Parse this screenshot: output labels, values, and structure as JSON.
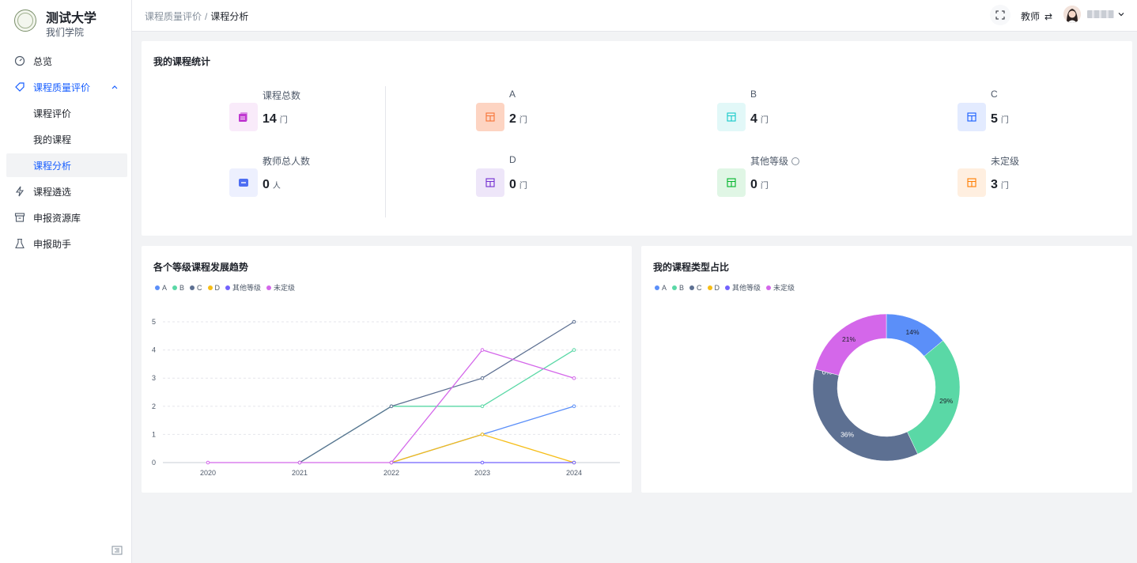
{
  "sidebar": {
    "university": "测试大学",
    "college": "我们学院",
    "items": [
      {
        "label": "总览"
      },
      {
        "label": "课程质量评价"
      },
      {
        "label": "课程评价"
      },
      {
        "label": "我的课程"
      },
      {
        "label": "课程分析"
      },
      {
        "label": "课程遴选"
      },
      {
        "label": "申报资源库"
      },
      {
        "label": "申报助手"
      }
    ]
  },
  "header": {
    "breadcrumb_parent": "课程质量评价",
    "breadcrumb_sep": "/",
    "breadcrumb_current": "课程分析",
    "role": "教师",
    "role_switch_icon": "⇄"
  },
  "stats": {
    "title": "我的课程统计",
    "items": [
      {
        "label": "课程总数",
        "value": "14",
        "unit": "门",
        "icon": "stack-icon",
        "color": "#c03ad1"
      },
      {
        "label": "A",
        "value": "2",
        "unit": "门",
        "icon": "table-icon",
        "color": "#f77234"
      },
      {
        "label": "B",
        "value": "4",
        "unit": "门",
        "icon": "table-icon",
        "color": "#14c9c9"
      },
      {
        "label": "C",
        "value": "5",
        "unit": "门",
        "icon": "table-icon",
        "color": "#165dff"
      },
      {
        "label": "教师总人数",
        "value": "0",
        "unit": "人",
        "icon": "card-icon",
        "color": "#4e6ef2"
      },
      {
        "label": "D",
        "value": "0",
        "unit": "门",
        "icon": "table-icon",
        "color": "#722ed1"
      },
      {
        "label": "其他等级",
        "value": "0",
        "unit": "门",
        "icon": "table-icon",
        "color": "#00b42a"
      },
      {
        "label": "未定级",
        "value": "3",
        "unit": "门",
        "icon": "table-icon",
        "color": "#ff7d00"
      }
    ]
  },
  "trend": {
    "title": "各个等级课程发展趋势"
  },
  "pie": {
    "title": "我的课程类型占比"
  },
  "colors": {
    "primary": "#165dff",
    "A": "#5b8ff9",
    "B": "#5ad8a6",
    "C": "#5d7092",
    "D": "#f6bd16",
    "other": "#7262fd",
    "ungraded": "#d467ea"
  },
  "chart_data": [
    {
      "type": "line",
      "x": [
        "2020",
        "2021",
        "2022",
        "2023",
        "2024"
      ],
      "ylim": [
        0,
        5
      ],
      "yticks": [
        "0",
        "1",
        "2",
        "3",
        "4",
        "5"
      ],
      "grid": true,
      "legend_position": "top-left",
      "series": [
        {
          "name": "A",
          "values": [
            0,
            0,
            0,
            1,
            2
          ],
          "color": "#5b8ff9"
        },
        {
          "name": "B",
          "values": [
            0,
            0,
            2,
            2,
            4
          ],
          "color": "#5ad8a6"
        },
        {
          "name": "C",
          "values": [
            0,
            0,
            2,
            3,
            5
          ],
          "color": "#5d7092"
        },
        {
          "name": "D",
          "values": [
            0,
            0,
            0,
            1,
            0
          ],
          "color": "#f6bd16"
        },
        {
          "name": "其他等级",
          "values": [
            0,
            0,
            0,
            0,
            0
          ],
          "color": "#7262fd"
        },
        {
          "name": "未定级",
          "values": [
            0,
            0,
            0,
            4,
            3
          ],
          "color": "#d467ea"
        }
      ]
    },
    {
      "type": "pie",
      "donut": true,
      "legend_position": "top-left",
      "slices": [
        {
          "name": "A",
          "value": 14,
          "label": "14%",
          "color": "#5b8ff9"
        },
        {
          "name": "B",
          "value": 29,
          "label": "29%",
          "color": "#5ad8a6"
        },
        {
          "name": "C",
          "value": 36,
          "label": "36%",
          "color": "#5d7092"
        },
        {
          "name": "D",
          "value": 0,
          "label": "0%",
          "color": "#f6bd16"
        },
        {
          "name": "其他等级",
          "value": 0,
          "label": "",
          "color": "#7262fd"
        },
        {
          "name": "未定级",
          "value": 21,
          "label": "21%",
          "color": "#d467ea"
        }
      ]
    }
  ]
}
